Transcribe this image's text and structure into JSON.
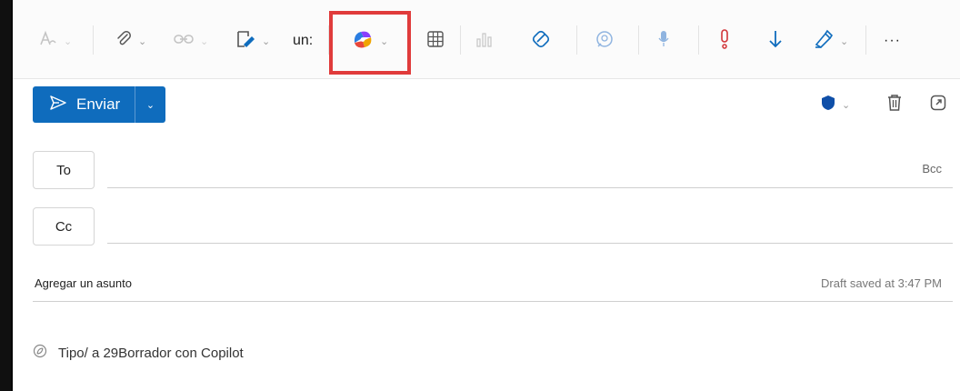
{
  "toolbar": {
    "format_label": "un:",
    "more_label": "···"
  },
  "compose": {
    "send_label": "Enviar",
    "to_label": "To",
    "cc_label": "Cc",
    "bcc_label": "Bcc",
    "subject_placeholder": "Agregar un asunto",
    "draft_status": "Draft saved at 3:47 PM",
    "body_hint": "Tipo/ a 29Borrador con Copilot"
  },
  "colors": {
    "accent": "#0f6cbd",
    "highlight": "#e03b3b"
  },
  "icons": [
    "editor-icon",
    "attach-icon",
    "link-icon",
    "signature-icon",
    "copilot-icon",
    "table-icon",
    "chart-icon",
    "loop-icon",
    "chat-icon",
    "dictate-icon",
    "importance-icon",
    "low-importance-icon",
    "sticker-icon",
    "more-icon",
    "sensitivity-icon",
    "discard-icon",
    "popout-icon"
  ]
}
